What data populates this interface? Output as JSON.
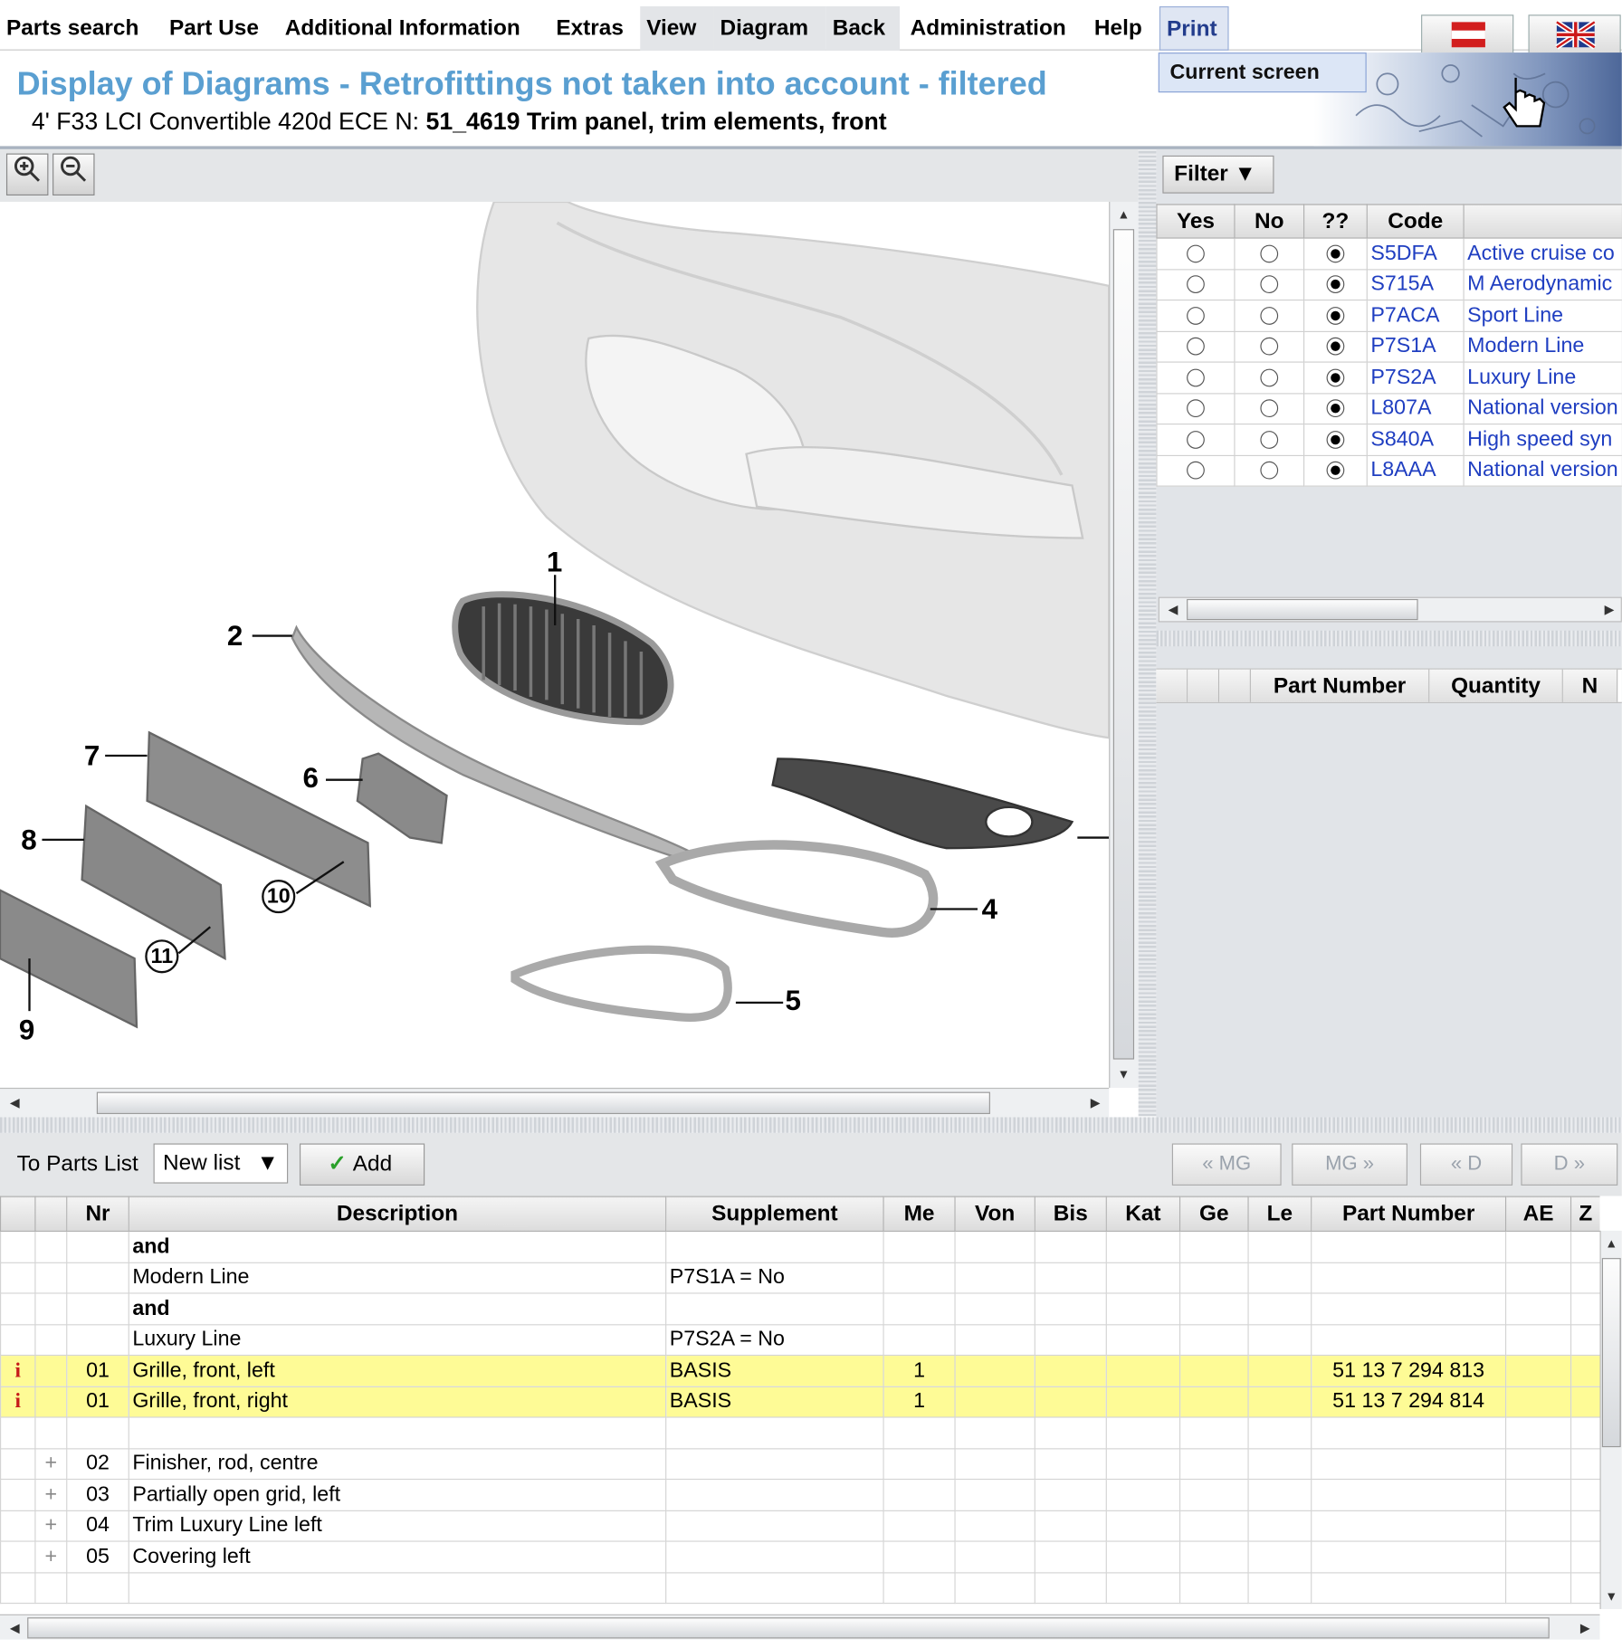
{
  "menu": {
    "items": [
      "Parts search",
      "Part Use",
      "Additional Information",
      "Extras",
      "View",
      "Diagram",
      "Back",
      "Administration",
      "Help",
      "Print"
    ],
    "dropdown_item": "Current screen"
  },
  "header": {
    "title": "Display of Diagrams - Retrofittings not taken into account - filtered",
    "vehicle": "4' F33 LCI Convertible 420d ECE",
    "n_prefix": "N:",
    "group": "51_4619 Trim panel, trim elements, front"
  },
  "diagram": {
    "callouts": [
      "1",
      "2",
      "4",
      "5",
      "6",
      "7",
      "8",
      "9"
    ],
    "circled": [
      "10",
      "11"
    ]
  },
  "filter": {
    "button_label": "Filter",
    "columns": [
      "Yes",
      "No",
      "??",
      "Code"
    ],
    "rows": [
      {
        "code": "S5DFA",
        "desc": "Active cruise co"
      },
      {
        "code": "S715A",
        "desc": "M Aerodynamic"
      },
      {
        "code": "P7ACA",
        "desc": "Sport Line"
      },
      {
        "code": "P7S1A",
        "desc": "Modern Line"
      },
      {
        "code": "P7S2A",
        "desc": "Luxury Line"
      },
      {
        "code": "L807A",
        "desc": "National version"
      },
      {
        "code": "S840A",
        "desc": "High speed syn"
      },
      {
        "code": "L8AAA",
        "desc": "National version"
      }
    ]
  },
  "partlist_panel": {
    "columns": [
      "Part Number",
      "Quantity",
      "N"
    ]
  },
  "toolbar": {
    "to_parts_list": "To Parts List",
    "list_value": "New list",
    "add_label": "Add",
    "nav": [
      "« MG",
      "MG »",
      "« D",
      "D »"
    ]
  },
  "parts": {
    "columns": [
      "",
      "",
      "Nr",
      "Description",
      "Supplement",
      "Me",
      "Von",
      "Bis",
      "Kat",
      "Ge",
      "Le",
      "Part Number",
      "AE",
      "Z"
    ],
    "rows": [
      {
        "mark": "",
        "plus": "",
        "nr": "",
        "desc": "and",
        "supp": "",
        "me": "",
        "pn": "",
        "bold": true,
        "hl": false
      },
      {
        "mark": "",
        "plus": "",
        "nr": "",
        "desc": "Modern Line",
        "supp": "P7S1A = No",
        "me": "",
        "pn": "",
        "bold": false,
        "hl": false
      },
      {
        "mark": "",
        "plus": "",
        "nr": "",
        "desc": "and",
        "supp": "",
        "me": "",
        "pn": "",
        "bold": true,
        "hl": false
      },
      {
        "mark": "",
        "plus": "",
        "nr": "",
        "desc": "Luxury Line",
        "supp": "P7S2A = No",
        "me": "",
        "pn": "",
        "bold": false,
        "hl": false
      },
      {
        "mark": "i",
        "plus": "",
        "nr": "01",
        "desc": "Grille, front, left",
        "supp": "BASIS",
        "me": "1",
        "pn": "51 13 7 294 813",
        "bold": false,
        "hl": true
      },
      {
        "mark": "i",
        "plus": "",
        "nr": "01",
        "desc": "Grille, front, right",
        "supp": "BASIS",
        "me": "1",
        "pn": "51 13 7 294 814",
        "bold": false,
        "hl": true
      },
      {
        "mark": "",
        "plus": "",
        "nr": "",
        "desc": "",
        "supp": "",
        "me": "",
        "pn": "",
        "bold": false,
        "hl": false
      },
      {
        "mark": "",
        "plus": "+",
        "nr": "02",
        "desc": "Finisher, rod, centre",
        "supp": "",
        "me": "",
        "pn": "",
        "bold": false,
        "hl": false
      },
      {
        "mark": "",
        "plus": "+",
        "nr": "03",
        "desc": "Partially open grid, left",
        "supp": "",
        "me": "",
        "pn": "",
        "bold": false,
        "hl": false
      },
      {
        "mark": "",
        "plus": "+",
        "nr": "04",
        "desc": "Trim Luxury Line left",
        "supp": "",
        "me": "",
        "pn": "",
        "bold": false,
        "hl": false
      },
      {
        "mark": "",
        "plus": "+",
        "nr": "05",
        "desc": "Covering left",
        "supp": "",
        "me": "",
        "pn": "",
        "bold": false,
        "hl": false
      },
      {
        "mark": "",
        "plus": "",
        "nr": "",
        "desc": "",
        "supp": "",
        "me": "",
        "pn": "",
        "bold": false,
        "hl": false
      }
    ]
  },
  "colors": {
    "title": "#5a9fd1",
    "code_link": "#1f3ec1",
    "highlight_row": "#fefb96",
    "info_mark": "#c61a1a"
  }
}
